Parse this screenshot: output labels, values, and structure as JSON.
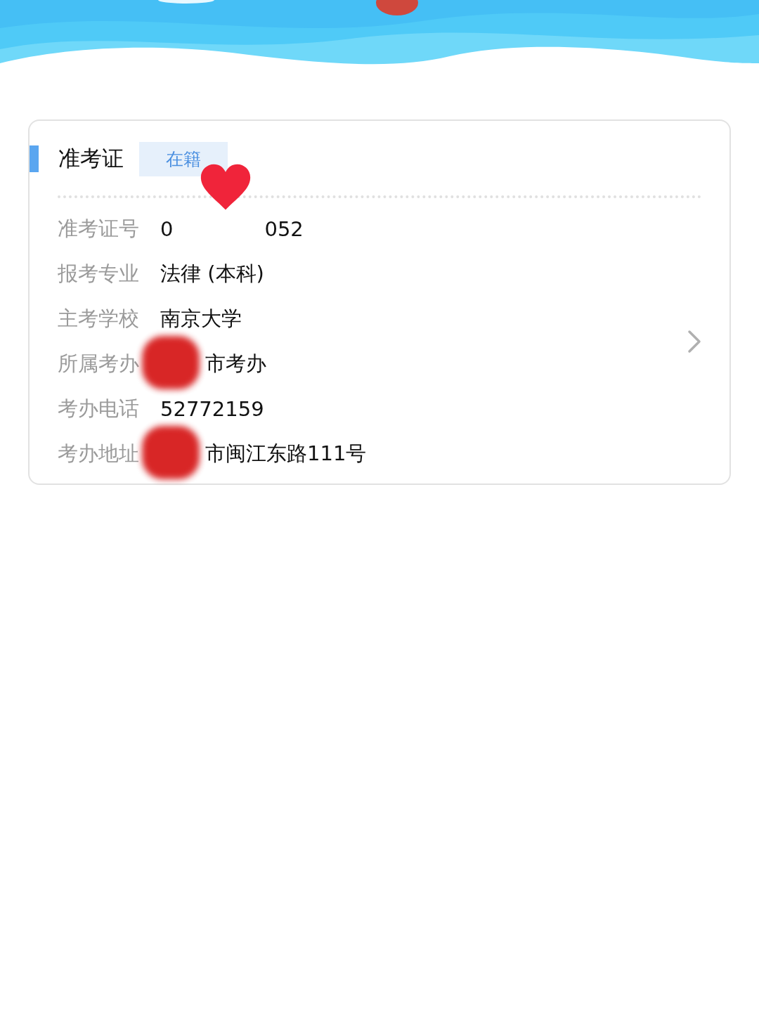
{
  "card": {
    "title": "准考证",
    "badge": "在籍",
    "rows": [
      {
        "kind": "sticker",
        "label": "准考证号",
        "value": [
          "0",
          "052"
        ]
      },
      {
        "kind": "plain",
        "label": "报考专业",
        "value": [
          "法律 (本科)"
        ]
      },
      {
        "kind": "plain",
        "label": "主考学校",
        "value": [
          "南京大学"
        ]
      },
      {
        "kind": "redacted",
        "label": "所属考办",
        "value": [
          "市考办"
        ]
      },
      {
        "kind": "plain",
        "label": "考办电话",
        "value": [
          "52772159"
        ]
      },
      {
        "kind": "redacted",
        "label": "考办地址",
        "value": [
          "市闽江东路111号"
        ]
      }
    ]
  }
}
